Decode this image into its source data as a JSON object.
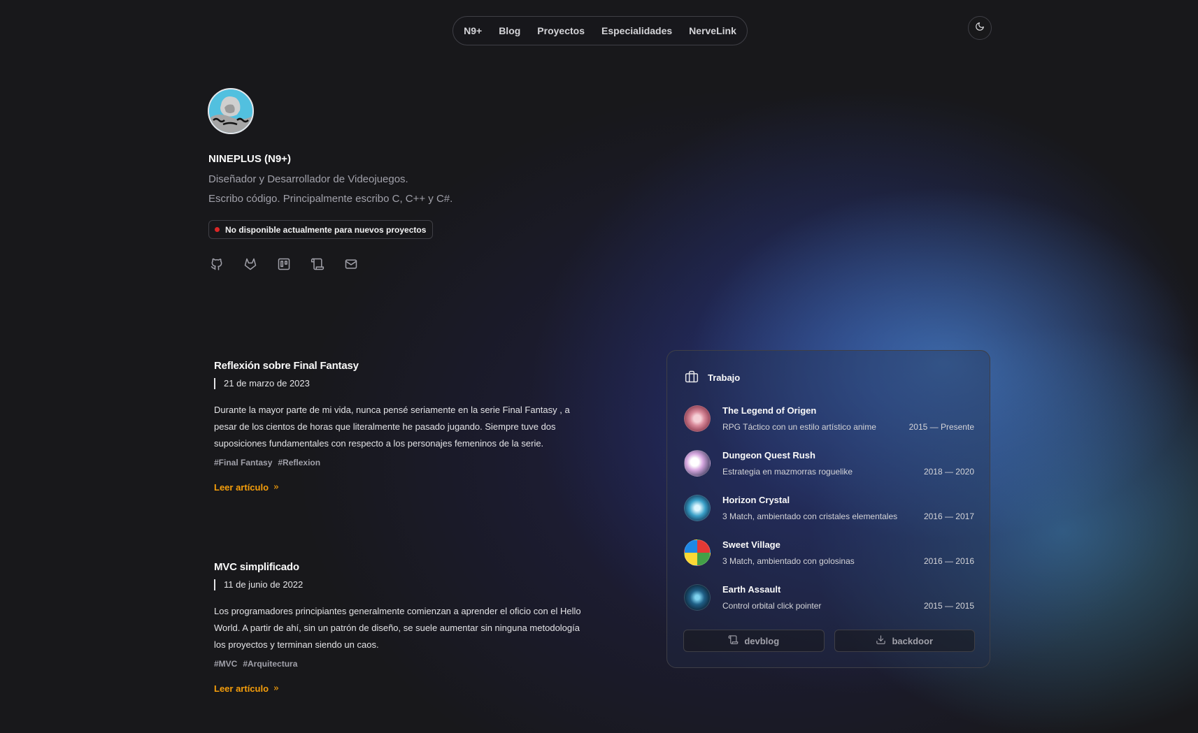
{
  "nav": {
    "items": [
      {
        "label": "N9+"
      },
      {
        "label": "Blog"
      },
      {
        "label": "Proyectos"
      },
      {
        "label": "Especialidades"
      },
      {
        "label": "NerveLink"
      }
    ],
    "theme_icon": "moon-icon"
  },
  "profile": {
    "name": "NINEPLUS (N9+)",
    "tagline_1": "Diseñador y Desarrollador de Videojuegos.",
    "tagline_2": "Escribo código. Principalmente escribo C, C++ y C#.",
    "status": "No disponible actualmente para nuevos proyectos",
    "status_color": "#dc2626",
    "socials": [
      "github-icon",
      "gitlab-icon",
      "trello-icon",
      "scroll-icon",
      "mail-icon"
    ]
  },
  "articles": [
    {
      "title": "Reflexión sobre Final Fantasy",
      "date": "21 de marzo de 2023",
      "excerpt": "Durante la mayor parte de mi vida, nunca pensé seriamente en la serie Final Fantasy , a pesar de los cientos de horas que literalmente he pasado jugando. Siempre tuve dos suposiciones fundamentales con respecto a los personajes femeninos de la serie.",
      "tags": [
        "#Final Fantasy",
        "#Reflexion"
      ],
      "read_label": "Leer artículo"
    },
    {
      "title": "MVC simplificado",
      "date": "11 de junio de 2022",
      "excerpt": "Los programadores principiantes generalmente comienzan a aprender el oficio con el Hello World. A partir de ahí, sin un patrón de diseño, se suele aumentar sin ninguna metodología los proyectos y terminan siendo un caos.",
      "tags": [
        "#MVC",
        "#Arquitectura"
      ],
      "read_label": "Leer artículo"
    }
  ],
  "work": {
    "heading": "Trabajo",
    "jobs": [
      {
        "title": "The Legend of Origen",
        "desc": "RPG Táctico con un estilo artístico anime",
        "years": "2015 — Presente"
      },
      {
        "title": "Dungeon Quest Rush",
        "desc": "Estrategia en mazmorras roguelike",
        "years": "2018 — 2020"
      },
      {
        "title": "Horizon Crystal",
        "desc": "3 Match, ambientado con cristales elementales",
        "years": "2016 — 2017"
      },
      {
        "title": "Sweet Village",
        "desc": "3 Match, ambientado con golosinas",
        "years": "2016 — 2016"
      },
      {
        "title": "Earth Assault",
        "desc": "Control orbital click pointer",
        "years": "2015 — 2015"
      }
    ],
    "buttons": [
      {
        "label": "devblog",
        "icon": "scroll-icon"
      },
      {
        "label": "backdoor",
        "icon": "download-icon"
      }
    ]
  },
  "colors": {
    "accent_link": "#f59e0b",
    "background": "#18181b"
  }
}
